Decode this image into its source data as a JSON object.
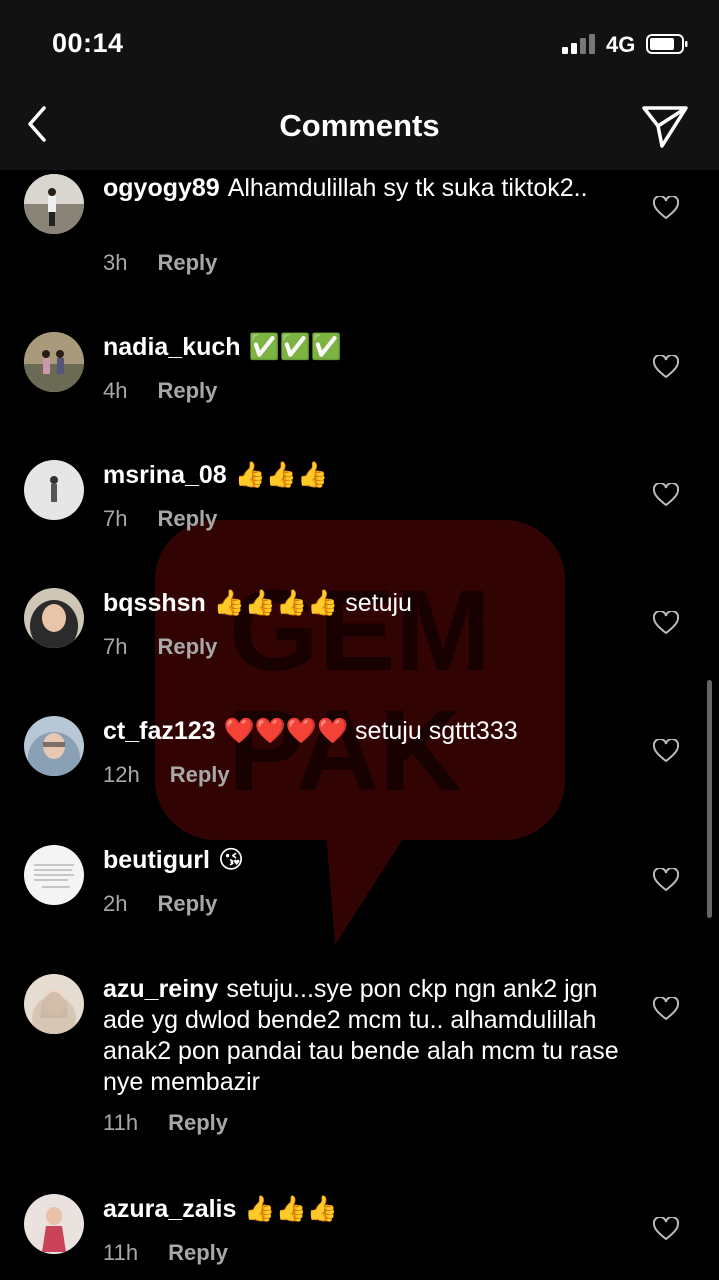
{
  "status_bar": {
    "time": "00:14",
    "network": "4G"
  },
  "header": {
    "title": "Comments"
  },
  "comments": [
    {
      "username": "ogyogy89",
      "text": "Alhamdulillah sy tk suka tiktok2..",
      "time": "3h",
      "reply": "Reply"
    },
    {
      "username": "nadia_kuch",
      "text": "✅✅✅",
      "time": "4h",
      "reply": "Reply"
    },
    {
      "username": "msrina_08",
      "text": "👍👍👍",
      "time": "7h",
      "reply": "Reply"
    },
    {
      "username": "bqsshsn",
      "text": "👍👍👍👍 setuju",
      "time": "7h",
      "reply": "Reply"
    },
    {
      "username": "ct_faz123",
      "text": "❤️❤️❤️❤️ setuju sgttt333",
      "time": "12h",
      "reply": "Reply"
    },
    {
      "username": "beutigurl",
      "text": "😘",
      "time": "2h",
      "reply": "Reply"
    },
    {
      "username": "azu_reiny",
      "text": "setuju...sye pon ckp ngn ank2 jgn ade yg dwlod bende2 mcm tu.. alhamdulillah anak2 pon pandai tau bende alah mcm tu rase nye membazir",
      "time": "11h",
      "reply": "Reply"
    },
    {
      "username": "azura_zalis",
      "text": "👍👍👍",
      "time": "11h",
      "reply": "Reply"
    }
  ],
  "colors": {
    "background": "#000000",
    "bar": "#121212",
    "meta_text": "#a8a8a8",
    "watermark": "#7a0a0a"
  },
  "watermark": {
    "text": "GEMPAK"
  }
}
